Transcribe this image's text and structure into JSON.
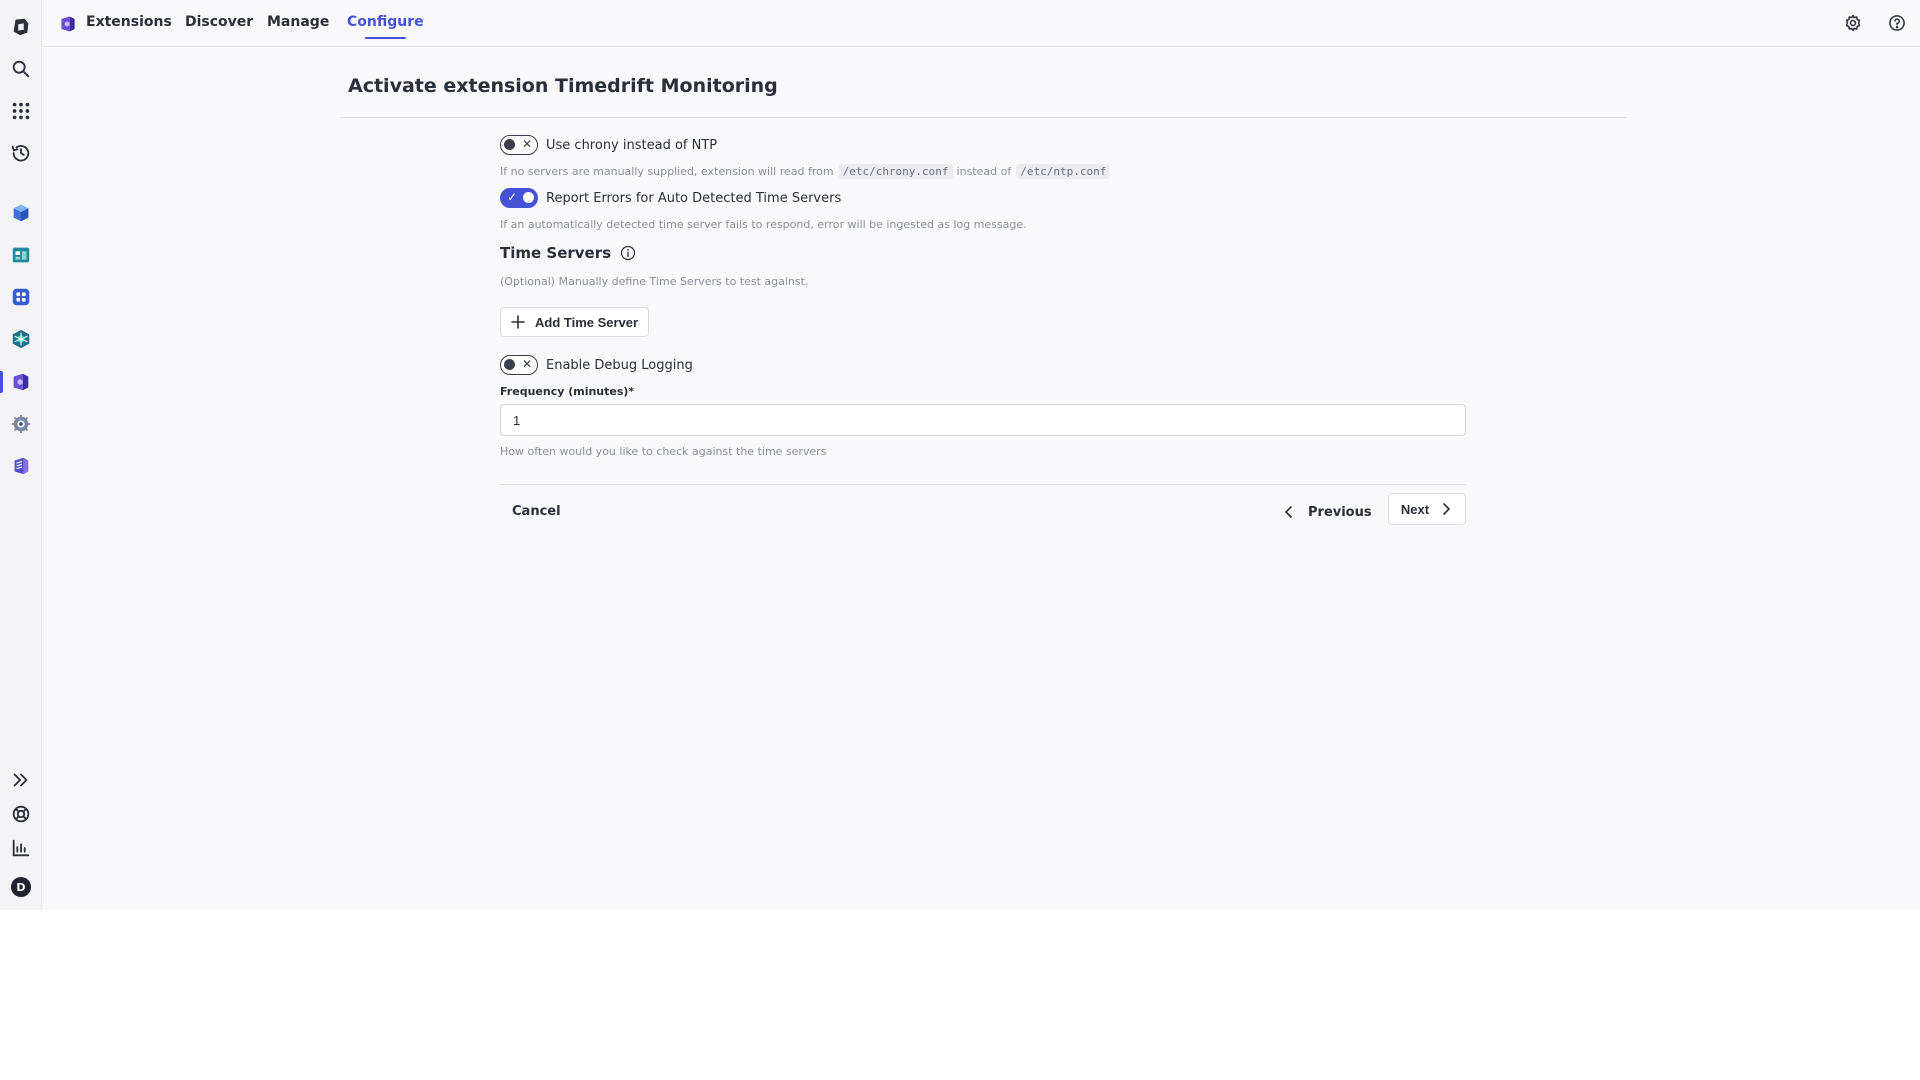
{
  "topbar": {
    "app_icon": "extensions-app-icon",
    "tabs": [
      {
        "label": "Extensions",
        "active": false
      },
      {
        "label": "Discover",
        "active": false
      },
      {
        "label": "Manage",
        "active": false
      },
      {
        "label": "Configure",
        "active": true
      }
    ],
    "right_icons": [
      "settings-gear-icon",
      "help-question-icon"
    ]
  },
  "rail": {
    "top_icons": [
      "dynatrace-logo-icon",
      "search-icon",
      "apps-grid-icon",
      "history-icon"
    ],
    "app_icons": [
      "cube-app-icon",
      "dashboard-app-icon",
      "hub-app-icon",
      "kubernetes-app-icon",
      "extensions-app-icon",
      "settings-app-icon",
      "notebooks-app-icon"
    ],
    "active_app": "extensions-app-icon",
    "bottom_icons": [
      "expand-chevrons-icon",
      "support-icon",
      "analytics-icon"
    ],
    "user_initial": "D"
  },
  "page": {
    "title": "Activate extension Timedrift Monitoring"
  },
  "form": {
    "chrony_toggle": {
      "label": "Use chrony instead of NTP",
      "checked": false,
      "help_prefix": "If no servers are manually supplied, extension will read from",
      "help_code_1": "/etc/chrony.conf",
      "help_middle": "instead of",
      "help_code_2": "/etc/ntp.conf"
    },
    "report_errors_toggle": {
      "label": "Report Errors for Auto Detected Time Servers",
      "checked": true,
      "help": "If an automatically detected time server fails to respond, error will be ingested as log message."
    },
    "time_servers": {
      "heading": "Time Servers",
      "help": "(Optional) Manually define Time Servers to test against.",
      "add_button": "Add Time Server"
    },
    "debug_toggle": {
      "label": "Enable Debug Logging",
      "checked": false
    },
    "frequency": {
      "label": "Frequency (minutes)*",
      "value": "1",
      "help": "How often would you like to check against the time servers"
    }
  },
  "footer": {
    "cancel": "Cancel",
    "previous": "Previous",
    "next": "Next"
  },
  "colors": {
    "accent": "#4652d6",
    "text": "#2b2f3a",
    "muted": "#8a8e9a",
    "background": "#f9f9fb"
  }
}
